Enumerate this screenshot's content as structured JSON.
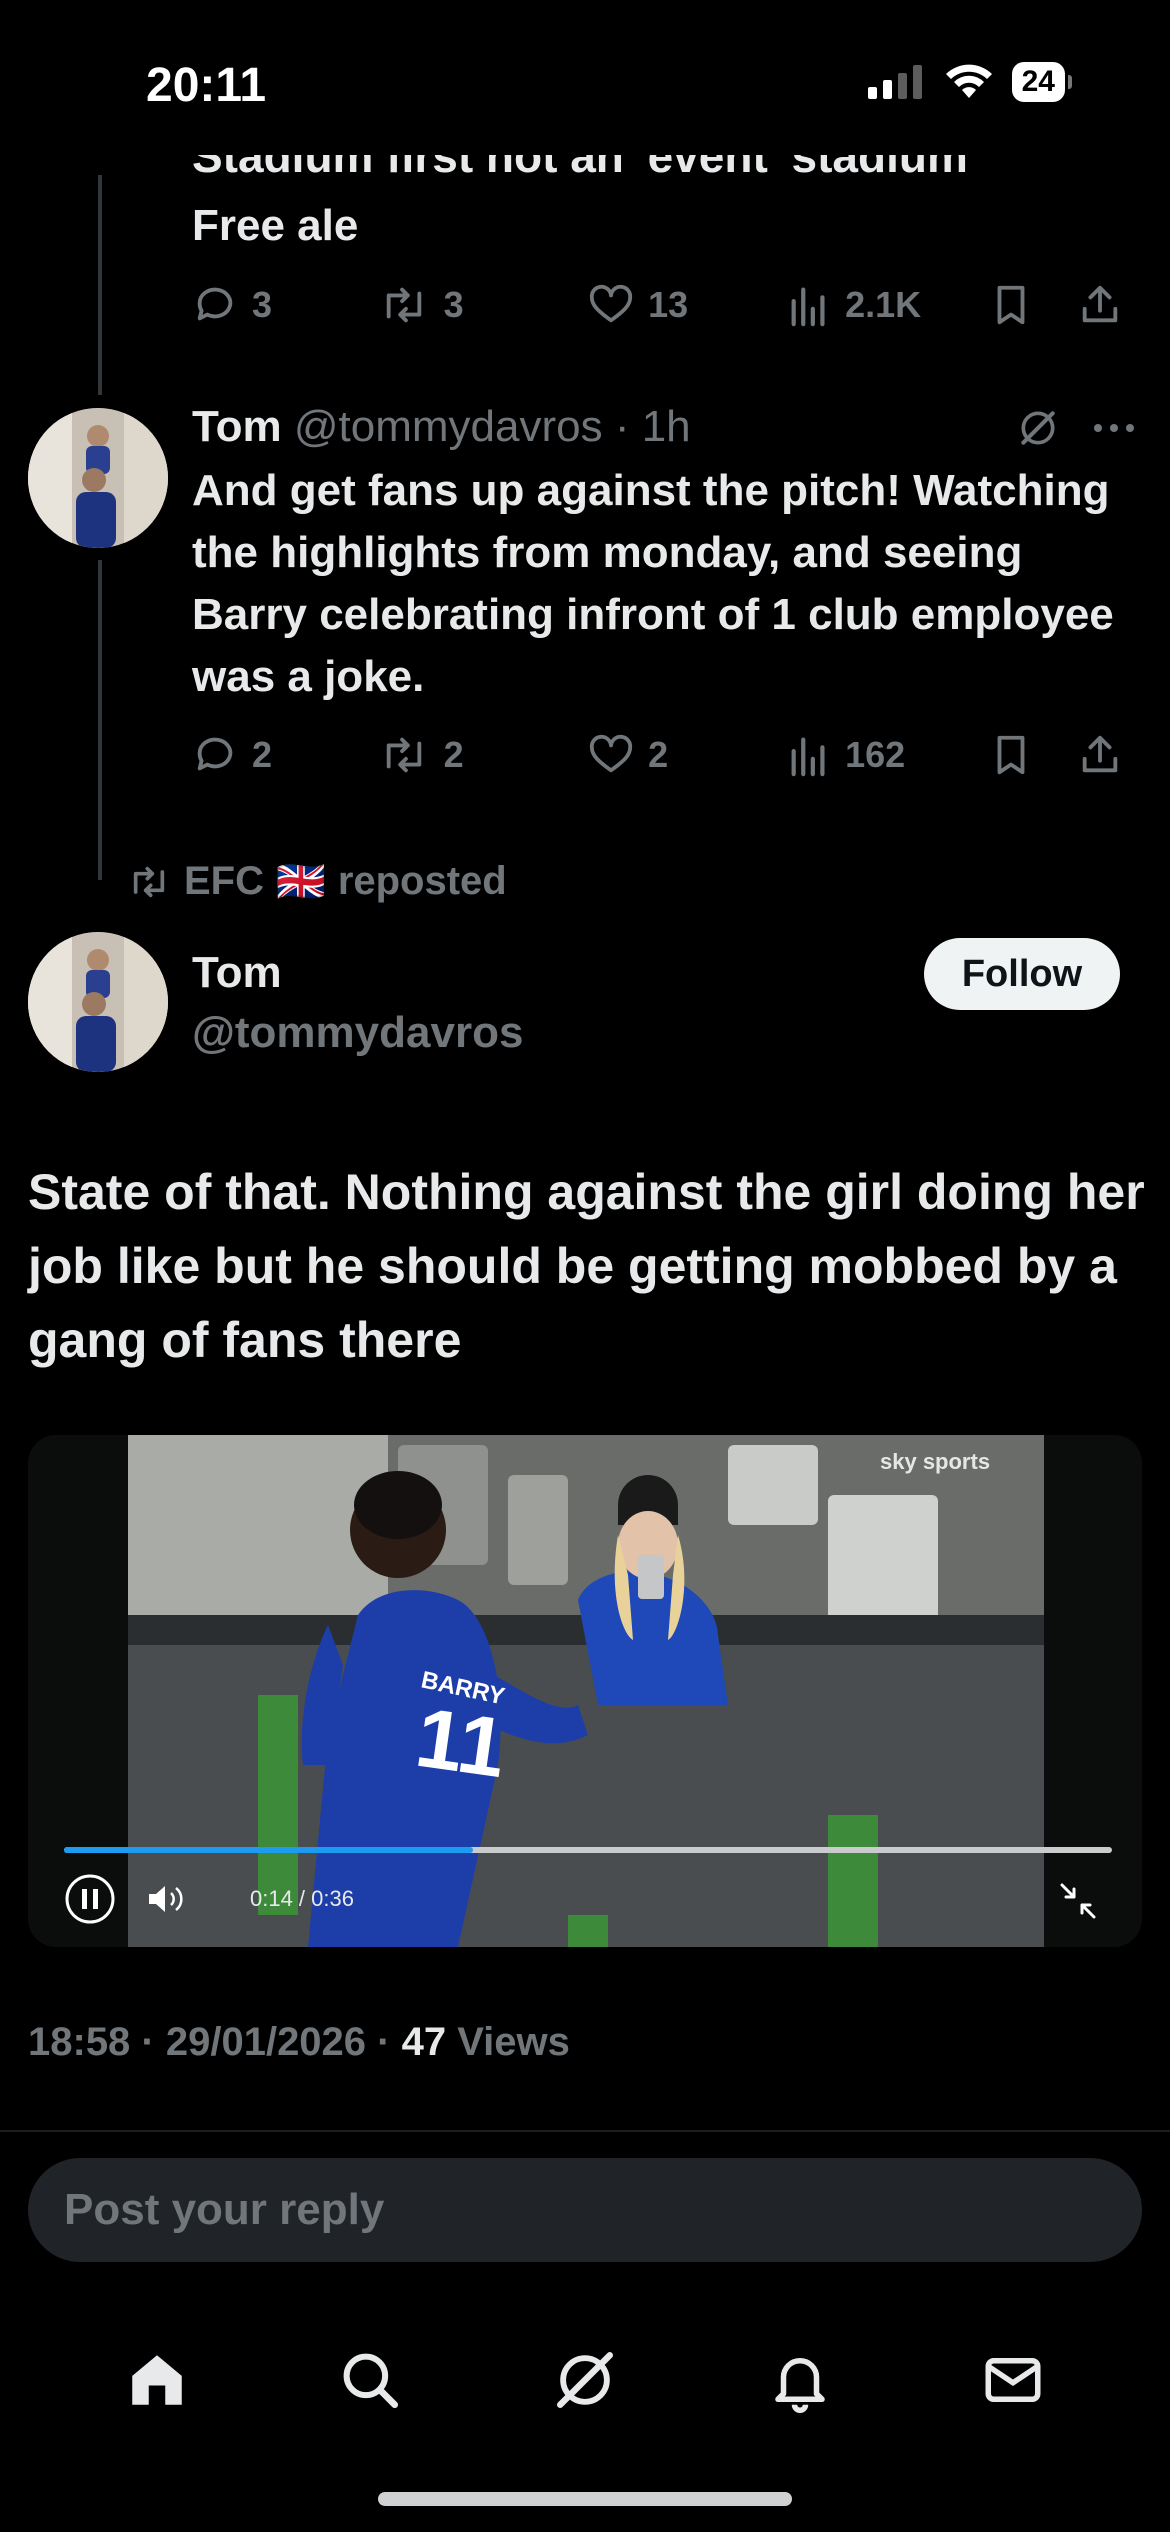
{
  "status_bar": {
    "time": "20:11",
    "battery": "24"
  },
  "prev_tweet": {
    "cutoff_text": "Stadium first not an 'event' stadium",
    "last_line": "Free ale",
    "replies": "3",
    "reposts": "3",
    "likes": "13",
    "views": "2.1K"
  },
  "reply_tweet": {
    "name": "Tom",
    "handle": "@tommydavros",
    "time": "· 1h",
    "text": "And get fans up against the pitch! Watching the highlights from monday, and seeing Barry celebrating infront of 1 club employee was a joke.",
    "replies": "2",
    "reposts": "2",
    "likes": "2",
    "views": "162"
  },
  "repost_banner": {
    "user": "EFC",
    "flag": "🇬🇧",
    "suffix": "reposted"
  },
  "main_tweet": {
    "name": "Tom",
    "handle": "@tommydavros",
    "follow_label": "Follow",
    "text": "State of that. Nothing against the girl doing her job like but he should  be getting mobbed by a gang of fans there",
    "video": {
      "time_label": "0:14 / 0:36",
      "progress": 0.39,
      "watermark": "sky sports",
      "player_name": "BARRY",
      "player_number": "11"
    },
    "timestamp": "18:58 · 29/01/2026 · ",
    "views_count": "47",
    "views_label": " Views"
  },
  "reply_box": {
    "placeholder": "Post your reply"
  },
  "tabbar": {
    "items": [
      {
        "icon": "home-icon"
      },
      {
        "icon": "search-icon"
      },
      {
        "icon": "grok-icon"
      },
      {
        "icon": "bell-icon"
      },
      {
        "icon": "mail-icon"
      }
    ]
  },
  "colors": {
    "accent": "#1d9bf0",
    "muted": "#71767b",
    "text": "#e7e9ea",
    "background": "#000000"
  }
}
